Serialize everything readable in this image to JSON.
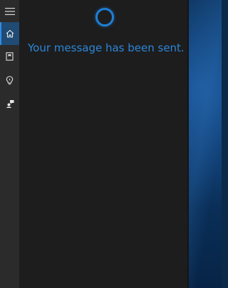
{
  "nav": {
    "items": [
      {
        "icon": "hamburger-menu-icon",
        "active": false
      },
      {
        "icon": "home-icon",
        "active": true
      },
      {
        "icon": "notebook-icon",
        "active": false
      },
      {
        "icon": "lightbulb-icon",
        "active": false
      },
      {
        "icon": "feedback-icon",
        "active": false
      }
    ]
  },
  "cortana": {
    "icon": "cortana-ring-icon",
    "message": "Your message has been sent."
  },
  "colors": {
    "accent": "#2b86d8",
    "panel": "#1d1d1d",
    "rail": "#2b2b2b",
    "active_nav": "#1f4b74"
  }
}
